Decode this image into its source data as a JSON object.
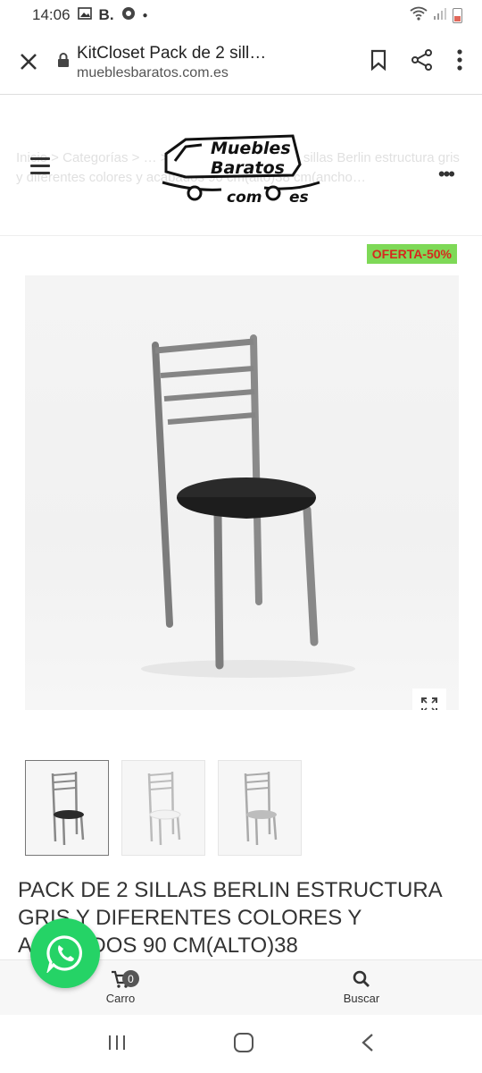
{
  "status_bar": {
    "time": "14:06",
    "carrier_letter": "B."
  },
  "browser": {
    "page_title": "KitCloset Pack de 2 sill…",
    "domain": "mueblesbaratos.com.es"
  },
  "site": {
    "logo_line1": "Muebles",
    "logo_line2": "Baratos",
    "logo_line3": "com",
    "logo_line4": "es",
    "breadcrumb": "Inicio  >  Categorías  >  …  >  pack 2…  >  Pack de 2 sillas Berlin estructura gris y diferentes colores y acabados 90 cm(alto)38 cm(ancho…"
  },
  "product": {
    "badge": "OFERTA-50%",
    "title": "PACK DE 2 SILLAS BERLIN ESTRUCTURA GRIS Y DIFERENTES COLORES Y ACABADOS 90 CM(ALTO)38",
    "thumbnails": [
      {
        "seat_color": "#2b2b2b"
      },
      {
        "seat_color": "#f2f2f2"
      },
      {
        "seat_color": "#bdbdbd"
      }
    ]
  },
  "bottom_nav": {
    "cart_label": "Carro",
    "cart_count": "0",
    "search_label": "Buscar"
  },
  "colors": {
    "badge_bg": "#7ed957",
    "badge_text": "#d6281e",
    "whatsapp": "#25d366"
  }
}
